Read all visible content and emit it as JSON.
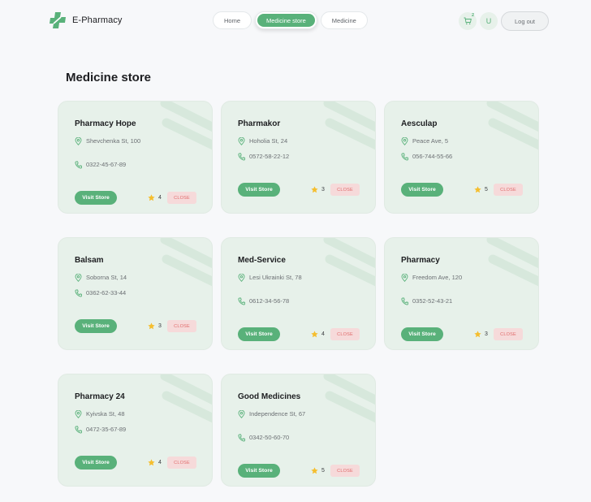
{
  "brand": {
    "name": "E-Pharmacy",
    "accent": "#59b17a"
  },
  "nav": {
    "items": [
      {
        "label": "Home"
      },
      {
        "label": "Medicine store"
      },
      {
        "label": "Medicine"
      }
    ],
    "active": "Medicine store"
  },
  "header": {
    "cart_count": "2",
    "user_initial": "U",
    "logout_label": "Log out",
    "cart_icon": "cart-icon"
  },
  "page": {
    "title": "Medicine store"
  },
  "stores": [
    {
      "name": "Pharmacy Hope",
      "address": "Shevchenka St, 100",
      "phone": "0322-45-67-89",
      "rating": "4",
      "status": "CLOSE",
      "visit_label": "Visit Store"
    },
    {
      "name": "Pharmakor",
      "address": "Hoholia St, 24",
      "phone": "0572-58-22-12",
      "rating": "3",
      "status": "CLOSE",
      "visit_label": "Visit Store"
    },
    {
      "name": "Aesculap",
      "address": "Peace Ave, 5",
      "phone": "056-744-55-66",
      "rating": "5",
      "status": "CLOSE",
      "visit_label": "Visit Store"
    },
    {
      "name": "Balsam",
      "address": "Soborna St, 14",
      "phone": "0362-62-33-44",
      "rating": "3",
      "status": "CLOSE",
      "visit_label": "Visit Store"
    },
    {
      "name": "Med-Service",
      "address": "Lesi Ukrainki St, 78",
      "phone": "0612-34-56-78",
      "rating": "4",
      "status": "CLOSE",
      "visit_label": "Visit Store"
    },
    {
      "name": "Pharmacy",
      "address": "Freedom Ave, 120",
      "phone": "0352-52-43-21",
      "rating": "3",
      "status": "CLOSE",
      "visit_label": "Visit Store"
    },
    {
      "name": "Pharmacy 24",
      "address": "Kyivska St, 48",
      "phone": "0472-35-67-89",
      "rating": "4",
      "status": "CLOSE",
      "visit_label": "Visit Store"
    },
    {
      "name": "Good Medicines",
      "address": "Independence St, 67",
      "phone": "0342-50-60-70",
      "rating": "5",
      "status": "CLOSE",
      "visit_label": "Visit Store"
    }
  ]
}
